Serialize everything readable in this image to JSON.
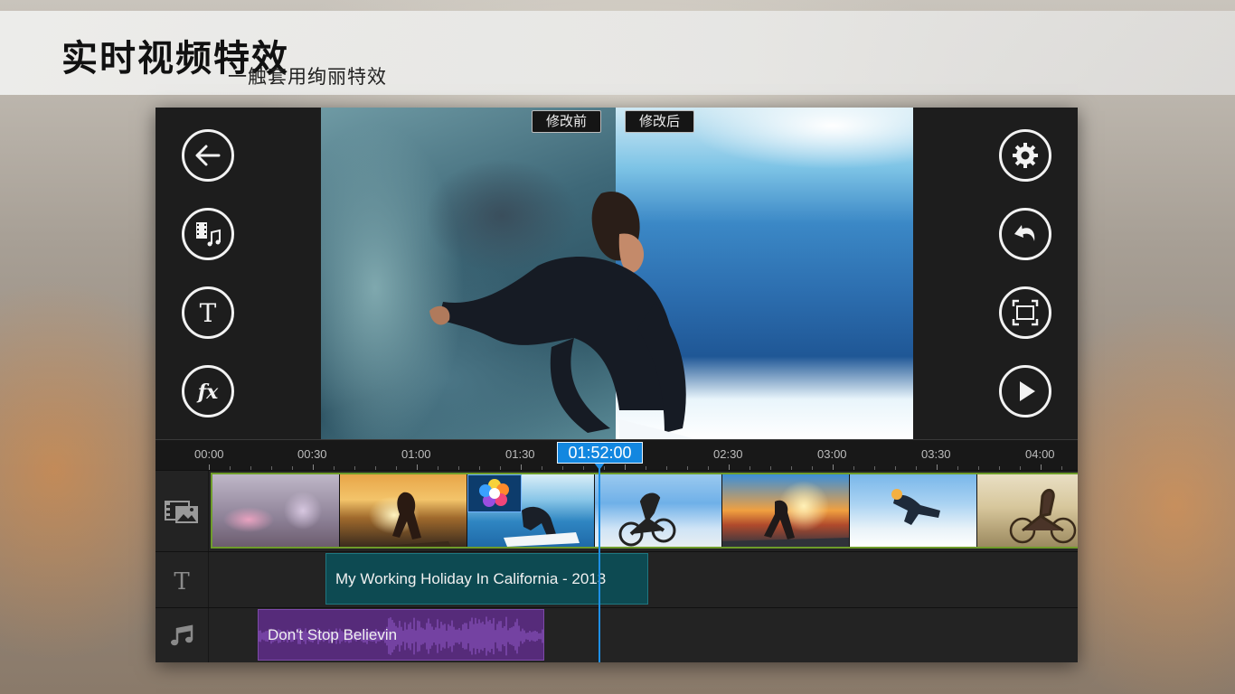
{
  "banner": {
    "title": "实时视频特效",
    "subtitle": "一触套用绚丽特效"
  },
  "preview": {
    "before_label": "修改前",
    "after_label": "修改后"
  },
  "left_toolbar": [
    "back-icon",
    "media-icon",
    "title-icon",
    "fx-icon"
  ],
  "right_toolbar": [
    "gear-icon",
    "undo-icon",
    "fullscreen-icon",
    "play-icon"
  ],
  "timeline": {
    "ticks": [
      "00:00",
      "00:30",
      "01:00",
      "01:30",
      "02:30",
      "03:00",
      "03:30",
      "04:00"
    ],
    "current_time": "01:52:00",
    "title_clip": "My Working Holiday In California - 2013",
    "audio_clip": "Don't Stop Believin"
  },
  "colors": {
    "playhead": "#1e8fe6",
    "video_track_border": "#6e9c2a",
    "title_clip": "#0d4a52",
    "audio_clip": "#562b7a"
  }
}
